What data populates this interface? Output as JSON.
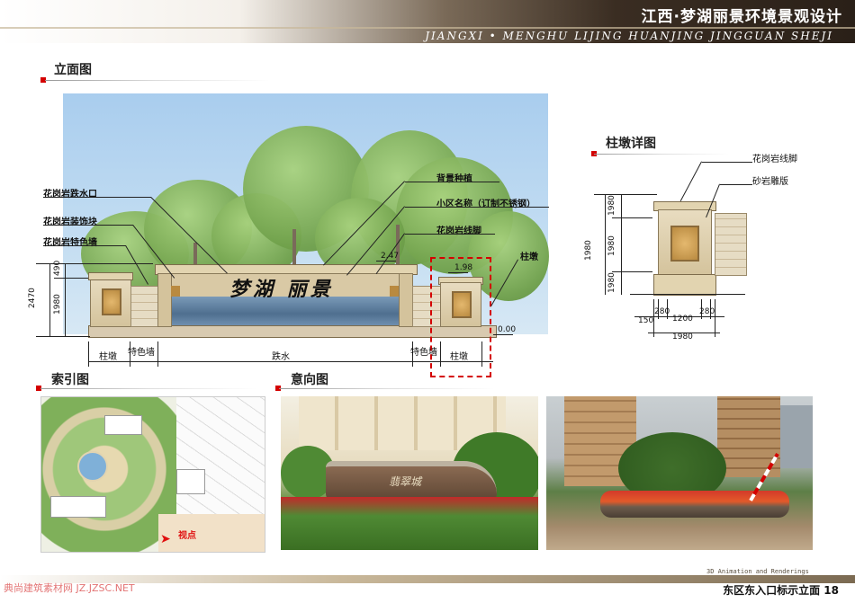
{
  "header": {
    "title_cn": "江西·梦湖丽景环境景观设计",
    "title_en": "JIANGXI • MENGHU LIJING HUANJING JINGGUAN  SHEJI"
  },
  "sections": {
    "elevation": "立面图",
    "pier_detail": "柱墩详图",
    "index_map": "索引图",
    "reference": "意向图"
  },
  "elevation": {
    "sign_text": "梦湖 丽景",
    "callouts": [
      "花岗岩跌水口",
      "花岗岩装饰块",
      "花岗岩特色墙",
      "背景种植",
      "小区名称（订制不锈钢）",
      "花岗岩线脚",
      "柱墩"
    ],
    "dims_left": [
      "490",
      "2470",
      "1980"
    ],
    "elevations": [
      "2.47",
      "1.98",
      "0.00"
    ],
    "bottom_labels": [
      "柱墩",
      "特色墙",
      "跌水",
      "特色墙",
      "柱墩"
    ]
  },
  "pier_detail": {
    "callouts": [
      "花岗岩线脚",
      "砂岩雕版"
    ],
    "dims_left": [
      "1980",
      "1980",
      "1980",
      "1980"
    ],
    "dims_bottom": [
      "150",
      "280",
      "1200",
      "280",
      "1980"
    ]
  },
  "index_map": {
    "viewpoint_label": "视点"
  },
  "photo_a": {
    "sign_text": "翡翠城"
  },
  "footer": {
    "page_label": "东区东入口标示立面 18",
    "watermark": "典尚建筑素材网 JZ.JZSC.NET",
    "small_text": "3D Animation and Renderings"
  },
  "colors": {
    "accent": "#d40000",
    "header_dark": "#2a2018",
    "stone": "#e6dcc4"
  }
}
